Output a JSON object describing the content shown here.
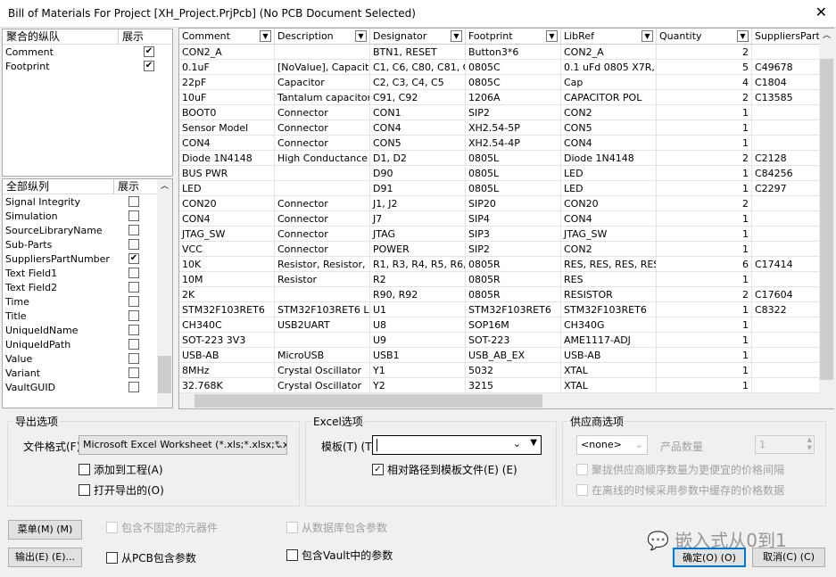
{
  "window": {
    "title": "Bill of Materials For Project [XH_Project.PrjPcb] (No PCB Document Selected)",
    "close": "✕"
  },
  "grouped": {
    "header": "聚合的纵队",
    "show": "展示",
    "items": [
      {
        "label": "Comment",
        "checked": true
      },
      {
        "label": "Footprint",
        "checked": true
      }
    ]
  },
  "all": {
    "header": "全部纵列",
    "show": "展示",
    "items": [
      {
        "label": "Signal Integrity",
        "checked": false
      },
      {
        "label": "Simulation",
        "checked": false
      },
      {
        "label": "SourceLibraryName",
        "checked": false
      },
      {
        "label": "Sub-Parts",
        "checked": false
      },
      {
        "label": "SuppliersPartNumber",
        "checked": true
      },
      {
        "label": "Text Field1",
        "checked": false
      },
      {
        "label": "Text Field2",
        "checked": false
      },
      {
        "label": "Time",
        "checked": false
      },
      {
        "label": "Title",
        "checked": false
      },
      {
        "label": "UniqueIdName",
        "checked": false
      },
      {
        "label": "UniqueIdPath",
        "checked": false
      },
      {
        "label": "Value",
        "checked": false
      },
      {
        "label": "Variant",
        "checked": false
      },
      {
        "label": "VaultGUID",
        "checked": false
      }
    ]
  },
  "table": {
    "columns": [
      "Comment",
      "Description",
      "Designator",
      "Footprint",
      "LibRef",
      "Quantity",
      "SuppliersPartNumber"
    ],
    "rows": [
      [
        "CON2_A",
        "",
        "BTN1, RESET",
        "Button3*6",
        "CON2_A",
        "2",
        ""
      ],
      [
        "0.1uF",
        "[NoValue], Capacitor",
        "C1, C6, C80, C81, C90",
        "0805C",
        "0.1 uFd 0805 X7R, Ca",
        "5",
        "C49678"
      ],
      [
        "22pF",
        "Capacitor",
        "C2, C3, C4, C5",
        "0805C",
        "Cap",
        "4",
        "C1804"
      ],
      [
        "10uF",
        "Tantalum capacitor 1",
        "C91, C92",
        "1206A",
        "CAPACITOR POL",
        "2",
        "C13585"
      ],
      [
        "BOOT0",
        "Connector",
        "CON1",
        "SIP2",
        "CON2",
        "1",
        ""
      ],
      [
        "Sensor Model",
        "Connector",
        "CON4",
        "XH2.54-5P",
        "CON5",
        "1",
        ""
      ],
      [
        "CON4",
        "Connector",
        "CON5",
        "XH2.54-4P",
        "CON4",
        "1",
        ""
      ],
      [
        "Diode 1N4148",
        "High Conductance F",
        "D1, D2",
        "0805L",
        "Diode 1N4148",
        "2",
        "C2128"
      ],
      [
        "BUS PWR",
        "",
        "D90",
        "0805L",
        "LED",
        "1",
        "C84256"
      ],
      [
        "LED",
        "",
        "D91",
        "0805L",
        "LED",
        "1",
        "C2297"
      ],
      [
        "CON20",
        "Connector",
        "J1, J2",
        "SIP20",
        "CON20",
        "2",
        ""
      ],
      [
        "CON4",
        "Connector",
        "J7",
        "SIP4",
        "CON4",
        "1",
        ""
      ],
      [
        "JTAG_SW",
        "Connector",
        "JTAG",
        "SIP3",
        "JTAG_SW",
        "1",
        ""
      ],
      [
        "VCC",
        "Connector",
        "POWER",
        "SIP2",
        "CON2",
        "1",
        ""
      ],
      [
        "10K",
        "Resistor, Resistor, Re",
        "R1, R3, R4, R5, R6, R",
        "0805R",
        "RES, RES, RES, RES, F",
        "6",
        "C17414"
      ],
      [
        "10M",
        "Resistor",
        "R2",
        "0805R",
        "RES",
        "1",
        ""
      ],
      [
        "2K",
        "",
        "R90, R92",
        "0805R",
        "RESISTOR",
        "2",
        "C17604"
      ],
      [
        "STM32F103RET6",
        "STM32F103RET6 LQF",
        "U1",
        "STM32F103RET6",
        "STM32F103RET6",
        "1",
        "C8322"
      ],
      [
        "CH340C",
        "USB2UART",
        "U8",
        "SOP16M",
        "CH340G",
        "1",
        ""
      ],
      [
        "SOT-223 3V3",
        "",
        "U9",
        "SOT-223",
        "AME1117-ADJ",
        "1",
        ""
      ],
      [
        "USB-AB",
        "MicroUSB",
        "USB1",
        "USB_AB_EX",
        "USB-AB",
        "1",
        ""
      ],
      [
        "8MHz",
        "Crystal Oscillator",
        "Y1",
        "5032",
        "XTAL",
        "1",
        ""
      ],
      [
        "32.768K",
        "Crystal Oscillator",
        "Y2",
        "3215",
        "XTAL",
        "1",
        ""
      ]
    ]
  },
  "export": {
    "legend": "导出选项",
    "format_label": "文件格式(F)",
    "format_value": "Microsoft Excel Worksheet (*.xls;*.xlsx;*.xl",
    "add_to_project": "添加到工程(A)",
    "open_exported": "打开导出的(O)"
  },
  "excel": {
    "legend": "Excel选项",
    "template_label": "模板(T) (T)",
    "template_value": "",
    "relative_path": "相对路径到模板文件(E) (E)",
    "relative_checked": true
  },
  "supplier": {
    "legend": "供应商选项",
    "supplier_value": "<none>",
    "qty_label": "产品数量",
    "qty_value": "1",
    "opt1": "聚拢供应商顺序数量为更便宜的价格间隔",
    "opt2": "在离线的时候采用参数中缓存的价格数据"
  },
  "options": {
    "menu": "菜单(M) (M)",
    "export": "输出(E) (E)...",
    "non_fitted": "包含不固定的元器件",
    "from_pcb": "从PCB包含参数",
    "from_db": "从数据库包含参数",
    "from_vault": "包含Vault中的参数"
  },
  "watermark": "嵌入式从0到1",
  "buttons": {
    "ok": "确定(O) (O)",
    "cancel": "取消(C) (C)"
  },
  "colors": {
    "focus": "#0078d7"
  }
}
